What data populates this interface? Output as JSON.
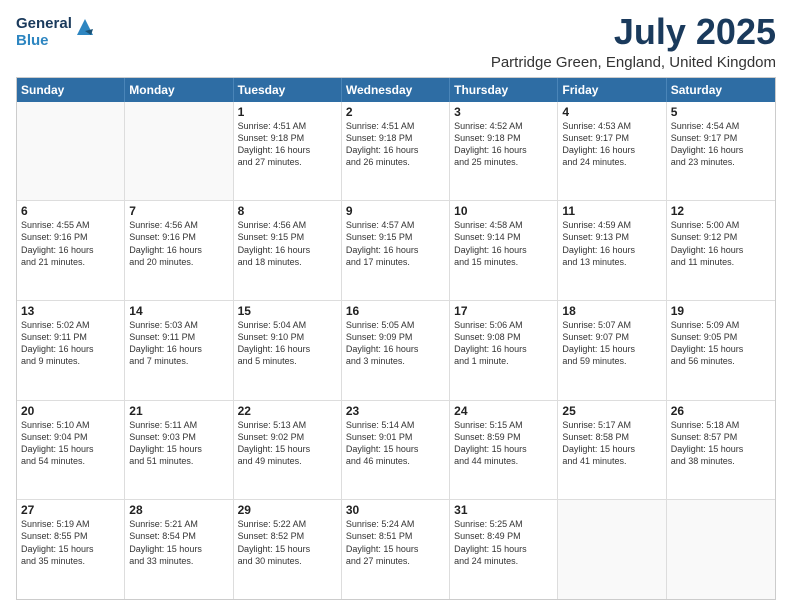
{
  "header": {
    "logo": {
      "general": "General",
      "blue": "Blue"
    },
    "title": "July 2025",
    "subtitle": "Partridge Green, England, United Kingdom"
  },
  "calendar": {
    "days": [
      "Sunday",
      "Monday",
      "Tuesday",
      "Wednesday",
      "Thursday",
      "Friday",
      "Saturday"
    ],
    "rows": [
      [
        {
          "day": "",
          "content": ""
        },
        {
          "day": "",
          "content": ""
        },
        {
          "day": "1",
          "content": "Sunrise: 4:51 AM\nSunset: 9:18 PM\nDaylight: 16 hours\nand 27 minutes."
        },
        {
          "day": "2",
          "content": "Sunrise: 4:51 AM\nSunset: 9:18 PM\nDaylight: 16 hours\nand 26 minutes."
        },
        {
          "day": "3",
          "content": "Sunrise: 4:52 AM\nSunset: 9:18 PM\nDaylight: 16 hours\nand 25 minutes."
        },
        {
          "day": "4",
          "content": "Sunrise: 4:53 AM\nSunset: 9:17 PM\nDaylight: 16 hours\nand 24 minutes."
        },
        {
          "day": "5",
          "content": "Sunrise: 4:54 AM\nSunset: 9:17 PM\nDaylight: 16 hours\nand 23 minutes."
        }
      ],
      [
        {
          "day": "6",
          "content": "Sunrise: 4:55 AM\nSunset: 9:16 PM\nDaylight: 16 hours\nand 21 minutes."
        },
        {
          "day": "7",
          "content": "Sunrise: 4:56 AM\nSunset: 9:16 PM\nDaylight: 16 hours\nand 20 minutes."
        },
        {
          "day": "8",
          "content": "Sunrise: 4:56 AM\nSunset: 9:15 PM\nDaylight: 16 hours\nand 18 minutes."
        },
        {
          "day": "9",
          "content": "Sunrise: 4:57 AM\nSunset: 9:15 PM\nDaylight: 16 hours\nand 17 minutes."
        },
        {
          "day": "10",
          "content": "Sunrise: 4:58 AM\nSunset: 9:14 PM\nDaylight: 16 hours\nand 15 minutes."
        },
        {
          "day": "11",
          "content": "Sunrise: 4:59 AM\nSunset: 9:13 PM\nDaylight: 16 hours\nand 13 minutes."
        },
        {
          "day": "12",
          "content": "Sunrise: 5:00 AM\nSunset: 9:12 PM\nDaylight: 16 hours\nand 11 minutes."
        }
      ],
      [
        {
          "day": "13",
          "content": "Sunrise: 5:02 AM\nSunset: 9:11 PM\nDaylight: 16 hours\nand 9 minutes."
        },
        {
          "day": "14",
          "content": "Sunrise: 5:03 AM\nSunset: 9:11 PM\nDaylight: 16 hours\nand 7 minutes."
        },
        {
          "day": "15",
          "content": "Sunrise: 5:04 AM\nSunset: 9:10 PM\nDaylight: 16 hours\nand 5 minutes."
        },
        {
          "day": "16",
          "content": "Sunrise: 5:05 AM\nSunset: 9:09 PM\nDaylight: 16 hours\nand 3 minutes."
        },
        {
          "day": "17",
          "content": "Sunrise: 5:06 AM\nSunset: 9:08 PM\nDaylight: 16 hours\nand 1 minute."
        },
        {
          "day": "18",
          "content": "Sunrise: 5:07 AM\nSunset: 9:07 PM\nDaylight: 15 hours\nand 59 minutes."
        },
        {
          "day": "19",
          "content": "Sunrise: 5:09 AM\nSunset: 9:05 PM\nDaylight: 15 hours\nand 56 minutes."
        }
      ],
      [
        {
          "day": "20",
          "content": "Sunrise: 5:10 AM\nSunset: 9:04 PM\nDaylight: 15 hours\nand 54 minutes."
        },
        {
          "day": "21",
          "content": "Sunrise: 5:11 AM\nSunset: 9:03 PM\nDaylight: 15 hours\nand 51 minutes."
        },
        {
          "day": "22",
          "content": "Sunrise: 5:13 AM\nSunset: 9:02 PM\nDaylight: 15 hours\nand 49 minutes."
        },
        {
          "day": "23",
          "content": "Sunrise: 5:14 AM\nSunset: 9:01 PM\nDaylight: 15 hours\nand 46 minutes."
        },
        {
          "day": "24",
          "content": "Sunrise: 5:15 AM\nSunset: 8:59 PM\nDaylight: 15 hours\nand 44 minutes."
        },
        {
          "day": "25",
          "content": "Sunrise: 5:17 AM\nSunset: 8:58 PM\nDaylight: 15 hours\nand 41 minutes."
        },
        {
          "day": "26",
          "content": "Sunrise: 5:18 AM\nSunset: 8:57 PM\nDaylight: 15 hours\nand 38 minutes."
        }
      ],
      [
        {
          "day": "27",
          "content": "Sunrise: 5:19 AM\nSunset: 8:55 PM\nDaylight: 15 hours\nand 35 minutes."
        },
        {
          "day": "28",
          "content": "Sunrise: 5:21 AM\nSunset: 8:54 PM\nDaylight: 15 hours\nand 33 minutes."
        },
        {
          "day": "29",
          "content": "Sunrise: 5:22 AM\nSunset: 8:52 PM\nDaylight: 15 hours\nand 30 minutes."
        },
        {
          "day": "30",
          "content": "Sunrise: 5:24 AM\nSunset: 8:51 PM\nDaylight: 15 hours\nand 27 minutes."
        },
        {
          "day": "31",
          "content": "Sunrise: 5:25 AM\nSunset: 8:49 PM\nDaylight: 15 hours\nand 24 minutes."
        },
        {
          "day": "",
          "content": ""
        },
        {
          "day": "",
          "content": ""
        }
      ]
    ]
  }
}
